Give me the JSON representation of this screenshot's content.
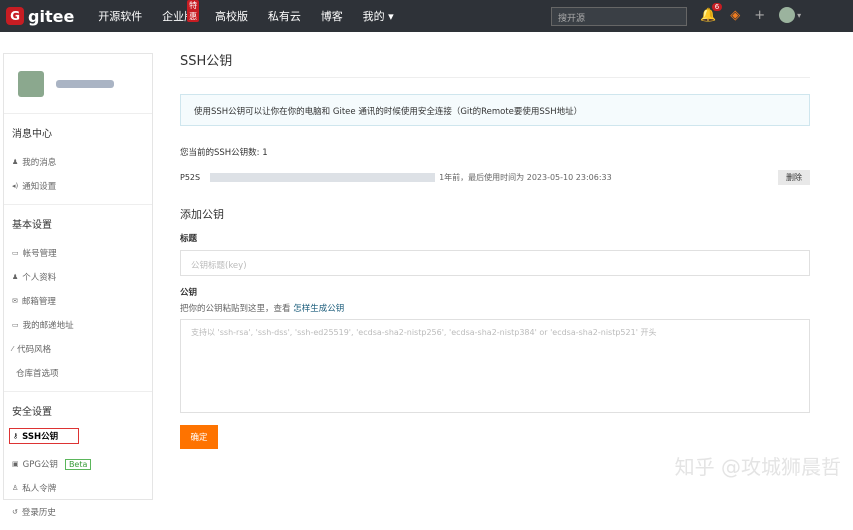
{
  "nav": {
    "brand": "gitee",
    "items": [
      "开源软件",
      "企业版",
      "高校版",
      "私有云",
      "博客",
      "我的"
    ],
    "badge": "特惠",
    "search_placeholder": "搜开源",
    "notif_count": "6"
  },
  "sidebar": {
    "sections": [
      {
        "title": "消息中心",
        "items": [
          {
            "icon": "bell-icon",
            "label": "我的消息"
          },
          {
            "icon": "volume-icon",
            "label": "通知设置"
          }
        ]
      },
      {
        "title": "基本设置",
        "items": [
          {
            "icon": "card-icon",
            "label": "帐号管理"
          },
          {
            "icon": "user-icon",
            "label": "个人资料"
          },
          {
            "icon": "mail-icon",
            "label": "邮箱管理"
          },
          {
            "icon": "address-icon",
            "label": "我的邮递地址"
          },
          {
            "icon": "brush-icon",
            "label": "代码风格"
          },
          {
            "icon": "code-icon",
            "label": "仓库首选项"
          }
        ]
      },
      {
        "title": "安全设置",
        "items": [
          {
            "icon": "key-icon",
            "label": "SSH公钥"
          },
          {
            "icon": "lock-icon",
            "label": "GPG公钥",
            "badge": "Beta"
          },
          {
            "icon": "token-icon",
            "label": "私人令牌"
          },
          {
            "icon": "history-icon",
            "label": "登录历史"
          }
        ]
      }
    ]
  },
  "main": {
    "title": "SSH公钥",
    "info": "使用SSH公钥可以让你在你的电脑和 Gitee 通讯的时候使用安全连接（Git的Remote要使用SSH地址）",
    "count": "您当前的SSH公钥数: 1",
    "key": {
      "name": "P52S",
      "meta": "1年前，最后使用时间为 2023-05-10 23:06:33",
      "delete": "删除"
    },
    "add_title": "添加公钥",
    "title_label": "标题",
    "title_placeholder": "公钥标题(key)",
    "key_label": "公钥",
    "key_hint": "把你的公钥粘贴到这里，查看",
    "key_hint_link": "怎样生成公钥",
    "key_placeholder": "支持以 'ssh-rsa', 'ssh-dss', 'ssh-ed25519', 'ecdsa-sha2-nistp256', 'ecdsa-sha2-nistp384' or 'ecdsa-sha2-nistp521' 开头",
    "submit": "确定"
  },
  "watermark": "知乎 @攻城狮晨哲"
}
